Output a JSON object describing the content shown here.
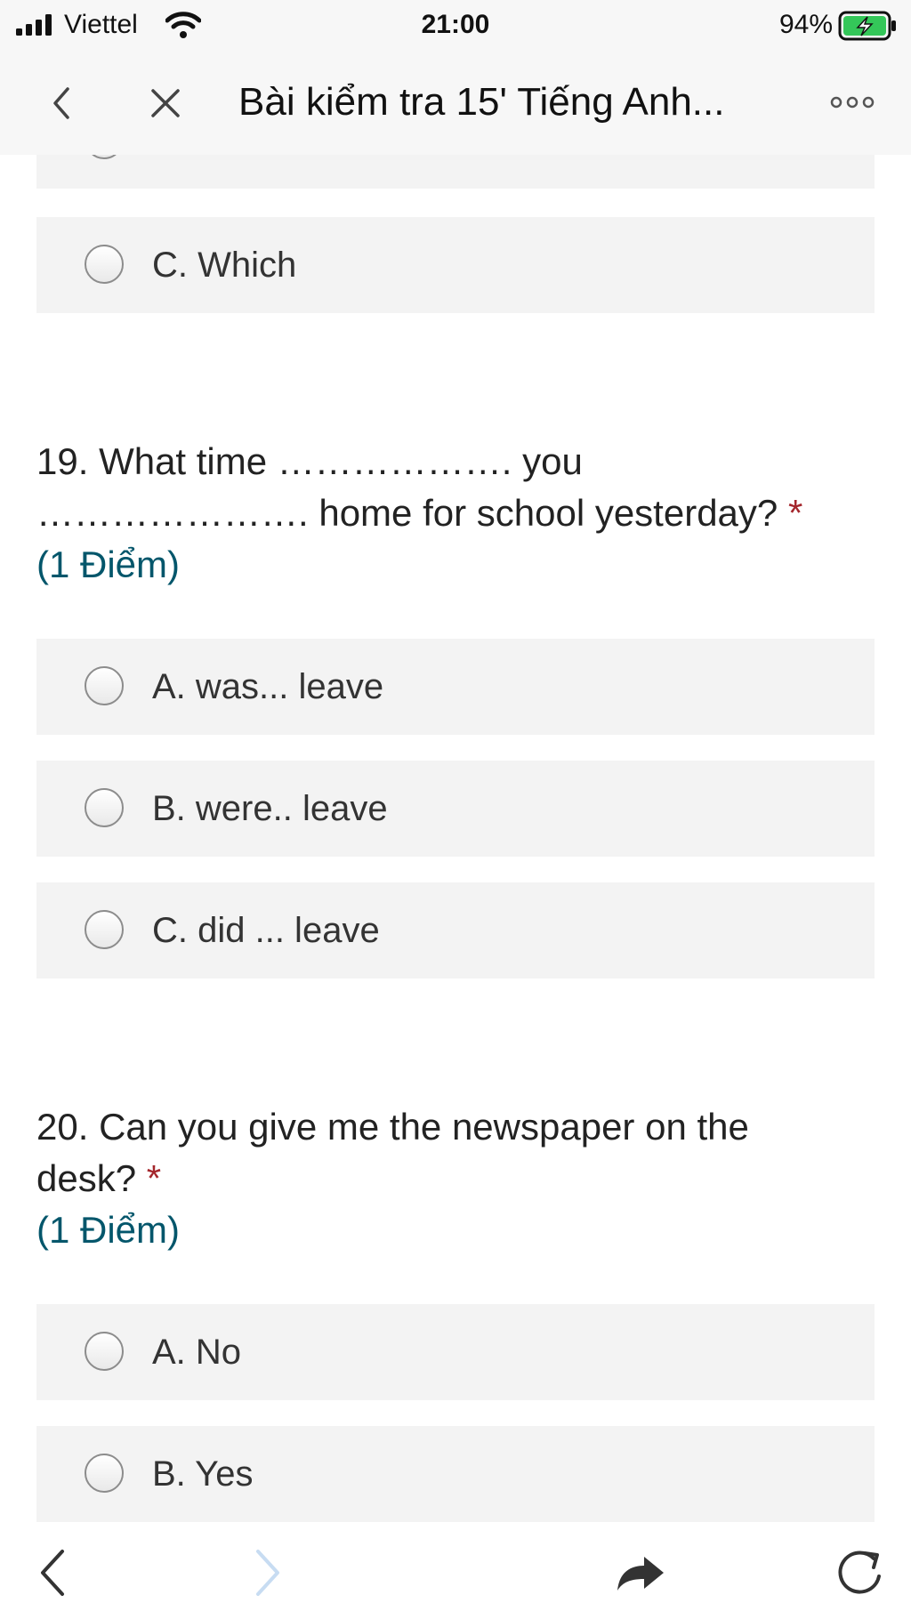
{
  "status_bar": {
    "carrier": "Viettel",
    "time": "21:00",
    "battery_percent": "94%",
    "battery_color": "#34c759"
  },
  "nav_bar": {
    "title": "Bài kiểm tra 15' Tiếng Anh...",
    "icons": [
      "chevron-left-icon",
      "close-icon",
      "more-icon"
    ]
  },
  "previous_question": {
    "option_c": "C. Which"
  },
  "question_19": {
    "number": "19.",
    "text_part1": "What time ………………. you",
    "text_part2": "…………………. home for school yesterday?",
    "required_mark": "*",
    "points": "(1 Điểm)",
    "options": [
      "A. was... leave",
      "B. were.. leave",
      "C. did ... leave"
    ]
  },
  "question_20": {
    "number": "20.",
    "text_part1": "Can you give me the newspaper on the",
    "text_part2": "desk?",
    "required_mark": "*",
    "points": "(1 Điểm)",
    "options": [
      "A. No",
      "B. Yes"
    ]
  },
  "toolbar": {
    "icons": [
      "back-arrow-icon",
      "forward-arrow-icon",
      "share-icon",
      "reload-icon"
    ]
  },
  "colors": {
    "option_background": "#f3f3f3",
    "required_star": "#a4262c",
    "points_text": "#03566b"
  }
}
